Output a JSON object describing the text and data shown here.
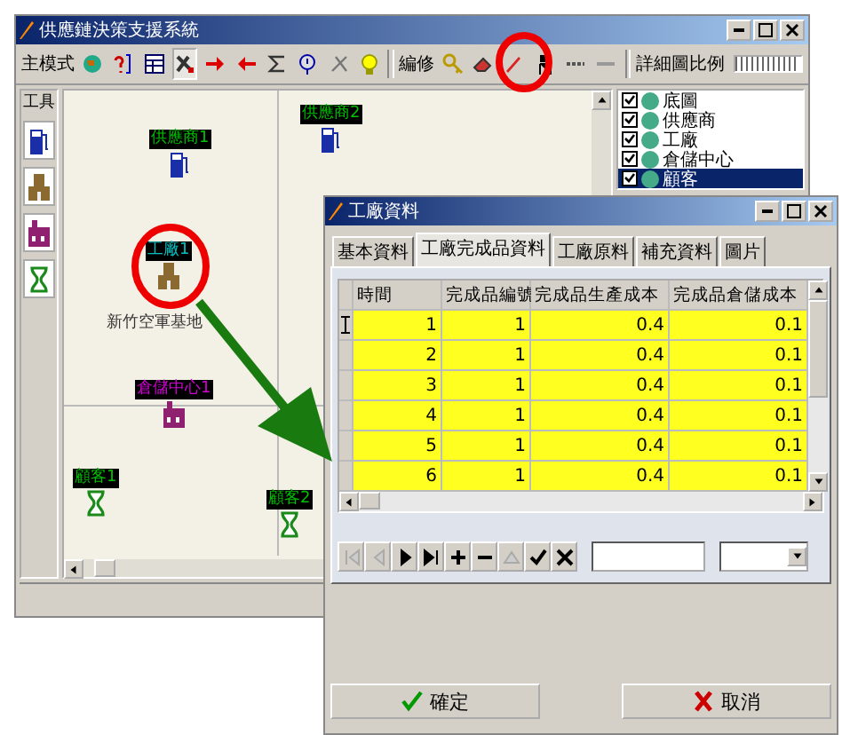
{
  "main_window": {
    "title": "供應鏈決策支援系統"
  },
  "toolbar": [
    {
      "kind": "label",
      "text": "主模式"
    },
    {
      "kind": "icon",
      "pressed": false
    },
    {
      "kind": "icon",
      "pressed": false
    },
    {
      "kind": "icon",
      "pressed": false
    },
    {
      "kind": "icon",
      "pressed": true
    },
    {
      "kind": "icon",
      "pressed": false
    },
    {
      "kind": "icon",
      "pressed": false
    },
    {
      "kind": "icon",
      "pressed": false
    },
    {
      "kind": "icon",
      "pressed": false
    },
    {
      "kind": "icon",
      "pressed": false
    },
    {
      "kind": "icon",
      "pressed": false
    },
    {
      "kind": "sep"
    },
    {
      "kind": "label",
      "text": "編修"
    },
    {
      "kind": "icon",
      "pressed": false
    },
    {
      "kind": "icon",
      "pressed": false
    },
    {
      "kind": "icon",
      "pressed": false
    },
    {
      "kind": "icon",
      "pressed": false
    },
    {
      "kind": "icon",
      "pressed": false
    },
    {
      "kind": "icon",
      "pressed": false
    },
    {
      "kind": "sep"
    },
    {
      "kind": "label",
      "text": "詳細圖比例"
    },
    {
      "kind": "slider",
      "level": 0.95
    }
  ],
  "tools_panel": {
    "title": "工具"
  },
  "map_nodes": [
    {
      "label": "供應商1",
      "kind": "supplier"
    },
    {
      "label": "供應商2",
      "kind": "supplier"
    },
    {
      "label": "工廠1",
      "kind": "factory"
    },
    {
      "label": "倉儲中心1",
      "kind": "warehouse"
    },
    {
      "label": "顧客1",
      "kind": "customer"
    },
    {
      "label": "顧客2",
      "kind": "customer"
    }
  ],
  "map_place": "新竹空軍基地",
  "layers": [
    {
      "label": "底圖",
      "checked": true,
      "selected": false
    },
    {
      "label": "供應商",
      "checked": true,
      "selected": false
    },
    {
      "label": "工廠",
      "checked": true,
      "selected": false
    },
    {
      "label": "倉儲中心",
      "checked": true,
      "selected": false
    },
    {
      "label": "顧客",
      "checked": true,
      "selected": true
    }
  ],
  "dialog": {
    "title": "工廠資料",
    "tabs": [
      {
        "label": "基本資料",
        "selected": false
      },
      {
        "label": "工廠完成品資料",
        "selected": true
      },
      {
        "label": "工廠原料",
        "selected": false
      },
      {
        "label": "補充資料",
        "selected": false
      },
      {
        "label": "圖片",
        "selected": false
      }
    ],
    "table": {
      "columns": [
        "時間",
        "完成品編號",
        "完成品生產成本",
        "完成品倉儲成本"
      ],
      "rows": [
        {
          "cells": [
            "1",
            "1",
            "0.4",
            "0.1"
          ],
          "current": true
        },
        {
          "cells": [
            "2",
            "1",
            "0.4",
            "0.1"
          ],
          "current": false
        },
        {
          "cells": [
            "3",
            "1",
            "0.4",
            "0.1"
          ],
          "current": false
        },
        {
          "cells": [
            "4",
            "1",
            "0.4",
            "0.1"
          ],
          "current": false
        },
        {
          "cells": [
            "5",
            "1",
            "0.4",
            "0.1"
          ],
          "current": false
        },
        {
          "cells": [
            "6",
            "1",
            "0.4",
            "0.1"
          ],
          "current": false
        }
      ]
    },
    "navigator": [
      {
        "kind": "first",
        "disabled": true
      },
      {
        "kind": "prior",
        "disabled": true
      },
      {
        "kind": "next",
        "disabled": false
      },
      {
        "kind": "last",
        "disabled": false
      },
      {
        "kind": "insert",
        "disabled": false
      },
      {
        "kind": "delete",
        "disabled": false
      },
      {
        "kind": "edit",
        "disabled": true
      },
      {
        "kind": "post",
        "disabled": false
      },
      {
        "kind": "cancel",
        "disabled": false
      }
    ],
    "ok_button": "確定",
    "cancel_button": "取消"
  }
}
